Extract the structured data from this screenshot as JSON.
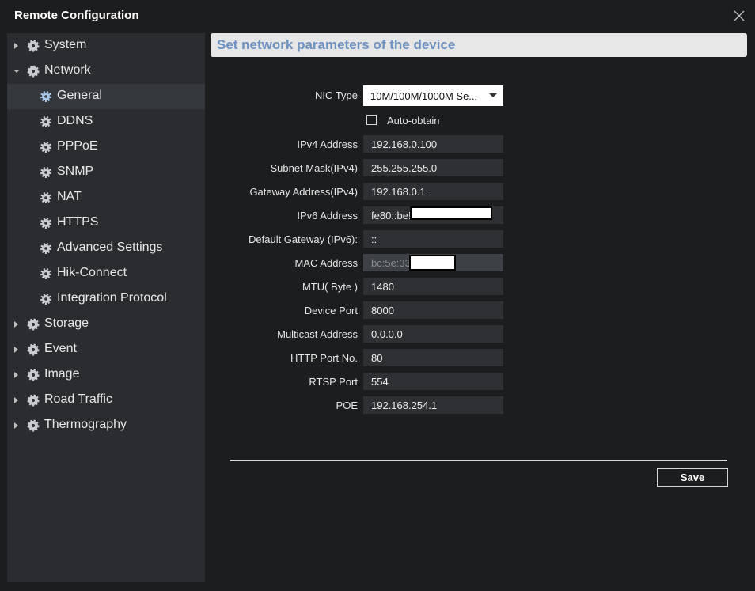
{
  "window": {
    "title": "Remote Configuration"
  },
  "sidebar": {
    "items": [
      {
        "label": "System",
        "level": 0,
        "arrow": "right",
        "icon": "gear-icon"
      },
      {
        "label": "Network",
        "level": 0,
        "arrow": "down",
        "icon": "gear-icon"
      },
      {
        "label": "General",
        "level": 1,
        "selected": true,
        "icon": "gear-icon"
      },
      {
        "label": "DDNS",
        "level": 1,
        "icon": "gear-icon"
      },
      {
        "label": "PPPoE",
        "level": 1,
        "icon": "gear-icon"
      },
      {
        "label": "SNMP",
        "level": 1,
        "icon": "gear-icon"
      },
      {
        "label": "NAT",
        "level": 1,
        "icon": "gear-icon"
      },
      {
        "label": "HTTPS",
        "level": 1,
        "icon": "gear-icon"
      },
      {
        "label": "Advanced Settings",
        "level": 1,
        "icon": "gear-icon"
      },
      {
        "label": "Hik-Connect",
        "level": 1,
        "icon": "gear-icon"
      },
      {
        "label": "Integration Protocol",
        "level": 1,
        "icon": "gear-icon"
      },
      {
        "label": "Storage",
        "level": 0,
        "arrow": "right",
        "icon": "gear-icon"
      },
      {
        "label": "Event",
        "level": 0,
        "arrow": "right",
        "icon": "gear-icon"
      },
      {
        "label": "Image",
        "level": 0,
        "arrow": "right",
        "icon": "gear-icon"
      },
      {
        "label": "Road Traffic",
        "level": 0,
        "arrow": "right",
        "icon": "gear-icon"
      },
      {
        "label": "Thermography",
        "level": 0,
        "arrow": "right",
        "icon": "gear-icon"
      }
    ]
  },
  "main": {
    "header": "Set network parameters of the device",
    "nic_type": {
      "label": "NIC Type",
      "value": "10M/100M/1000M Se..."
    },
    "auto_obtain": {
      "label": "Auto-obtain",
      "checked": false
    },
    "fields": [
      {
        "label": "IPv4 Address",
        "value": "192.168.0.100"
      },
      {
        "label": "Subnet Mask(IPv4)",
        "value": "255.255.255.0"
      },
      {
        "label": "Gateway Address(IPv4)",
        "value": "192.168.0.1"
      },
      {
        "label": "IPv6 Address",
        "value": "fe80::be!"
      },
      {
        "label": "Default Gateway (IPv6):",
        "value": "::"
      },
      {
        "label": "MAC Address",
        "value": "bc:5e:33",
        "disabled": true
      },
      {
        "label": "MTU( Byte )",
        "value": "1480"
      },
      {
        "label": "Device Port",
        "value": "8000"
      },
      {
        "label": "Multicast Address",
        "value": "0.0.0.0"
      },
      {
        "label": "HTTP Port No.",
        "value": "80"
      },
      {
        "label": "RTSP Port",
        "value": "554"
      },
      {
        "label": "POE",
        "value": "192.168.254.1"
      }
    ],
    "save_label": "Save"
  },
  "colors": {
    "header_text": "#6d92c2",
    "background": "#1c1d1f",
    "sidebar": "#2a2c2f"
  }
}
